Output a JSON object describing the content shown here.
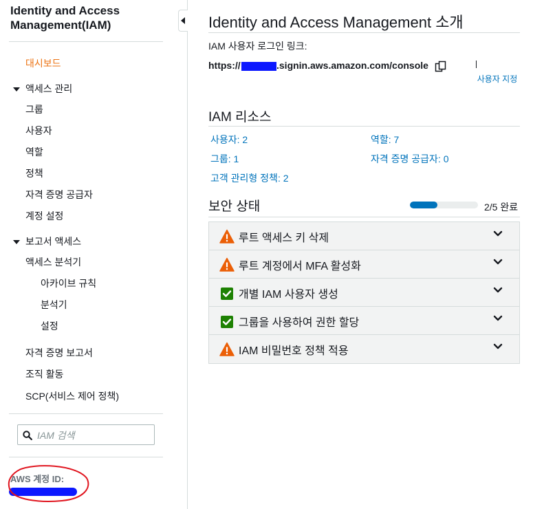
{
  "sidebar": {
    "title": "Identity and Access Management(IAM)",
    "dashboard": "대시보드",
    "access_management": {
      "label": "액세스 관리",
      "items": [
        "그룹",
        "사용자",
        "역할",
        "정책",
        "자격 증명 공급자",
        "계정 설정"
      ]
    },
    "reports": {
      "label": "보고서 액세스",
      "analyzer": "액세스 분석기",
      "analyzer_items": [
        "아카이브 규칙",
        "분석기",
        "설정"
      ],
      "items": [
        "자격 증명 보고서",
        "조직 활동",
        "SCP(서비스 제어 정책)"
      ]
    },
    "search": {
      "placeholder": "IAM 검색"
    },
    "account_id_label": "AWS 계정 ID:"
  },
  "main": {
    "title": "Identity and Access Management 소개",
    "signin": {
      "label": "IAM 사용자 로그인 링크:",
      "url_prefix": "https://",
      "url_suffix": ".signin.aws.amazon.com/console",
      "customize": "사용자 지정"
    },
    "resources": {
      "title": "IAM 리소스",
      "items": [
        {
          "label": "사용자: 2"
        },
        {
          "label": "역할: 7"
        },
        {
          "label": "그룹: 1"
        },
        {
          "label": "자격 증명 공급자: 0"
        },
        {
          "label": "고객 관리형 정책: 2"
        }
      ]
    },
    "security": {
      "title": "보안 상태",
      "progress_fraction": 0.4,
      "progress_text": "2/5 완료",
      "items": [
        {
          "label": "루트 액세스 키 삭제",
          "status": "warning"
        },
        {
          "label": "루트 계정에서 MFA 활성화",
          "status": "warning"
        },
        {
          "label": "개별 IAM 사용자 생성",
          "status": "complete"
        },
        {
          "label": "그룹을 사용하여 권한 할당",
          "status": "complete"
        },
        {
          "label": "IAM 비밀번호 정책 적용",
          "status": "warning"
        }
      ]
    }
  },
  "colors": {
    "accent_orange": "#ec7211",
    "link_blue": "#0073bb",
    "warning": "#eb5f07",
    "success": "#1d8102",
    "redaction": "#0c18ff",
    "annotation_red": "#e0141e"
  }
}
